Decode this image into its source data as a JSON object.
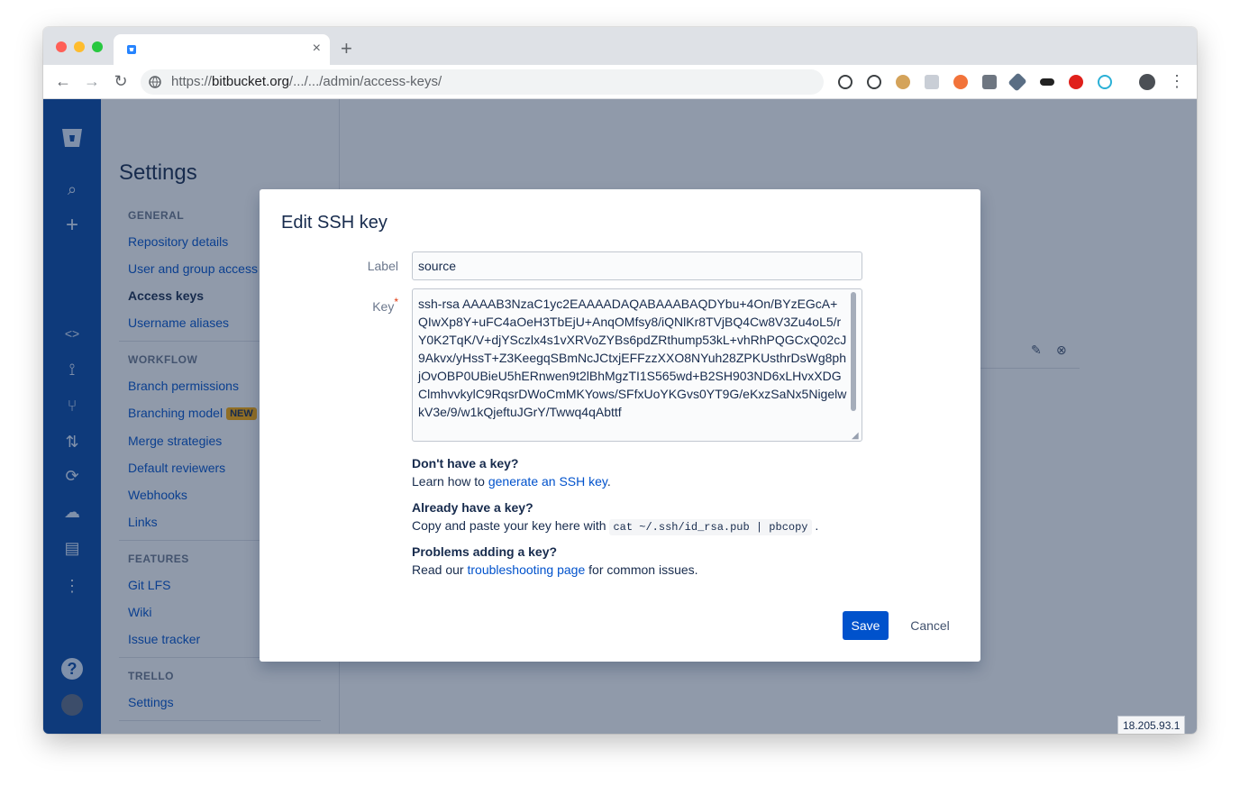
{
  "browser": {
    "tab_close": "×",
    "new_tab": "+",
    "url_prefix": "https://",
    "url_host": "bitbucket.org",
    "url_path": "/.../.../admin/access-keys/"
  },
  "settings": {
    "title": "Settings",
    "sections": [
      {
        "heading": "GENERAL",
        "items": [
          "Repository details",
          "User and group access",
          "Access keys",
          "Username aliases"
        ]
      },
      {
        "heading": "WORKFLOW",
        "items": [
          "Branch permissions",
          "Branching model",
          "Merge strategies",
          "Default reviewers",
          "Webhooks",
          "Links"
        ]
      },
      {
        "heading": "FEATURES",
        "items": [
          "Git LFS",
          "Wiki",
          "Issue tracker"
        ]
      },
      {
        "heading": "TRELLO",
        "items": [
          "Settings"
        ]
      }
    ],
    "new_badge": "NEW"
  },
  "modal": {
    "title": "Edit SSH key",
    "label_field": {
      "label": "Label",
      "value": "source"
    },
    "key_field": {
      "label": "Key",
      "required_mark": "*",
      "value": "ssh-rsa AAAAB3NzaC1yc2EAAAADAQABAAABAQDYbu+4On/BYzEGcA+QIwXp8Y+uFC4aOeH3TbEjU+AnqOMfsy8/iQNlKr8TVjBQ4Cw8V3Zu4oL5/rY0K2TqK/V+djYSczlx4s1vXRVoZYBs6pdZRthump53kL+vhRhPQGCxQ02cJ9Akvx/yHssT+Z3KeegqSBmNcJCtxjEFFzzXXO8NYuh28ZPKUsthrDsWg8phjOvOBP0UBieU5hERnwen9t2lBhMgzTI1S565wd+B2SH903ND6xLHvxXDGClmhvvkylC9RqsrDWoCmMKYows/SFfxUoYKGvs0YT9G/eKxzSaNx5NigelwkV3e/9/w1kQjeftuJGrY/Twwq4qAbttf"
    },
    "help": [
      {
        "heading": "Don't have a key?",
        "text_before": "Learn how to ",
        "link": "generate an SSH key",
        "text_after": "."
      },
      {
        "heading": "Already have a key?",
        "text_before": "Copy and paste your key here with ",
        "code": "cat ~/.ssh/id_rsa.pub | pbcopy",
        "text_after": " ."
      },
      {
        "heading": "Problems adding a key?",
        "text_before": "Read our ",
        "link": "troubleshooting page",
        "text_after": " for common issues."
      }
    ],
    "save_label": "Save",
    "cancel_label": "Cancel"
  },
  "ip_address": "18.205.93.1"
}
